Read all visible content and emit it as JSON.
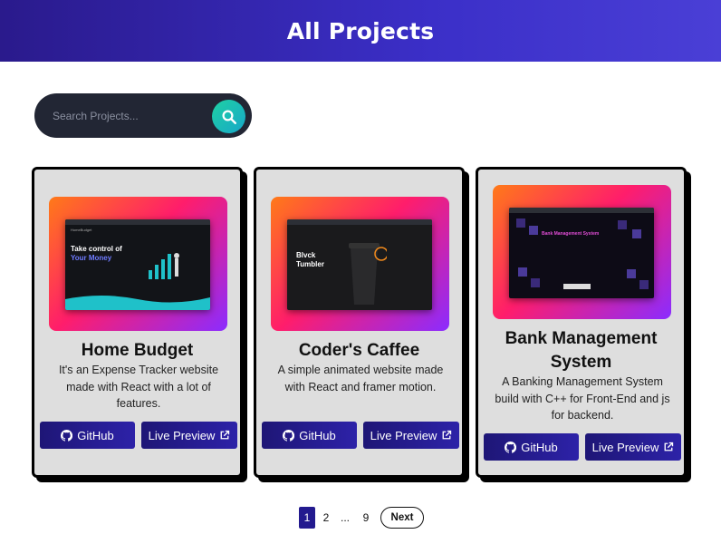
{
  "header": {
    "title": "All Projects"
  },
  "search": {
    "placeholder": "Search Projects..."
  },
  "projects": [
    {
      "title": "Home Budget",
      "description": "It's an Expense Tracker website made with React with a lot of features.",
      "github_label": "GitHub",
      "preview_label": "Live Preview",
      "thumb": {
        "brand": "HomeBudget",
        "headline_1": "Take control of",
        "headline_2": "Your Money"
      }
    },
    {
      "title": "Coder's Caffee",
      "description": "A simple animated website made with React and framer motion.",
      "github_label": "GitHub",
      "preview_label": "Live Preview",
      "thumb": {
        "headline_1": "Blvck",
        "headline_2": "Tumbler"
      }
    },
    {
      "title": "Bank Management System",
      "description": "A Banking Management System build with C++ for Front-End and js for backend.",
      "github_label": "GitHub",
      "preview_label": "Live Preview",
      "thumb": {
        "headline_1": "Bank Management System"
      }
    }
  ],
  "pagination": {
    "current": "1",
    "page_2": "2",
    "ellipsis": "...",
    "last": "9",
    "next": "Next"
  },
  "colors": {
    "header_start": "#2a1a8c",
    "header_end": "#4a3fd6",
    "button": "#231a8f",
    "search_accent": "#1fd1a3",
    "card_bg": "#dedede"
  },
  "icons": {
    "search": "search-icon",
    "github": "github-icon",
    "external": "external-link-icon"
  }
}
